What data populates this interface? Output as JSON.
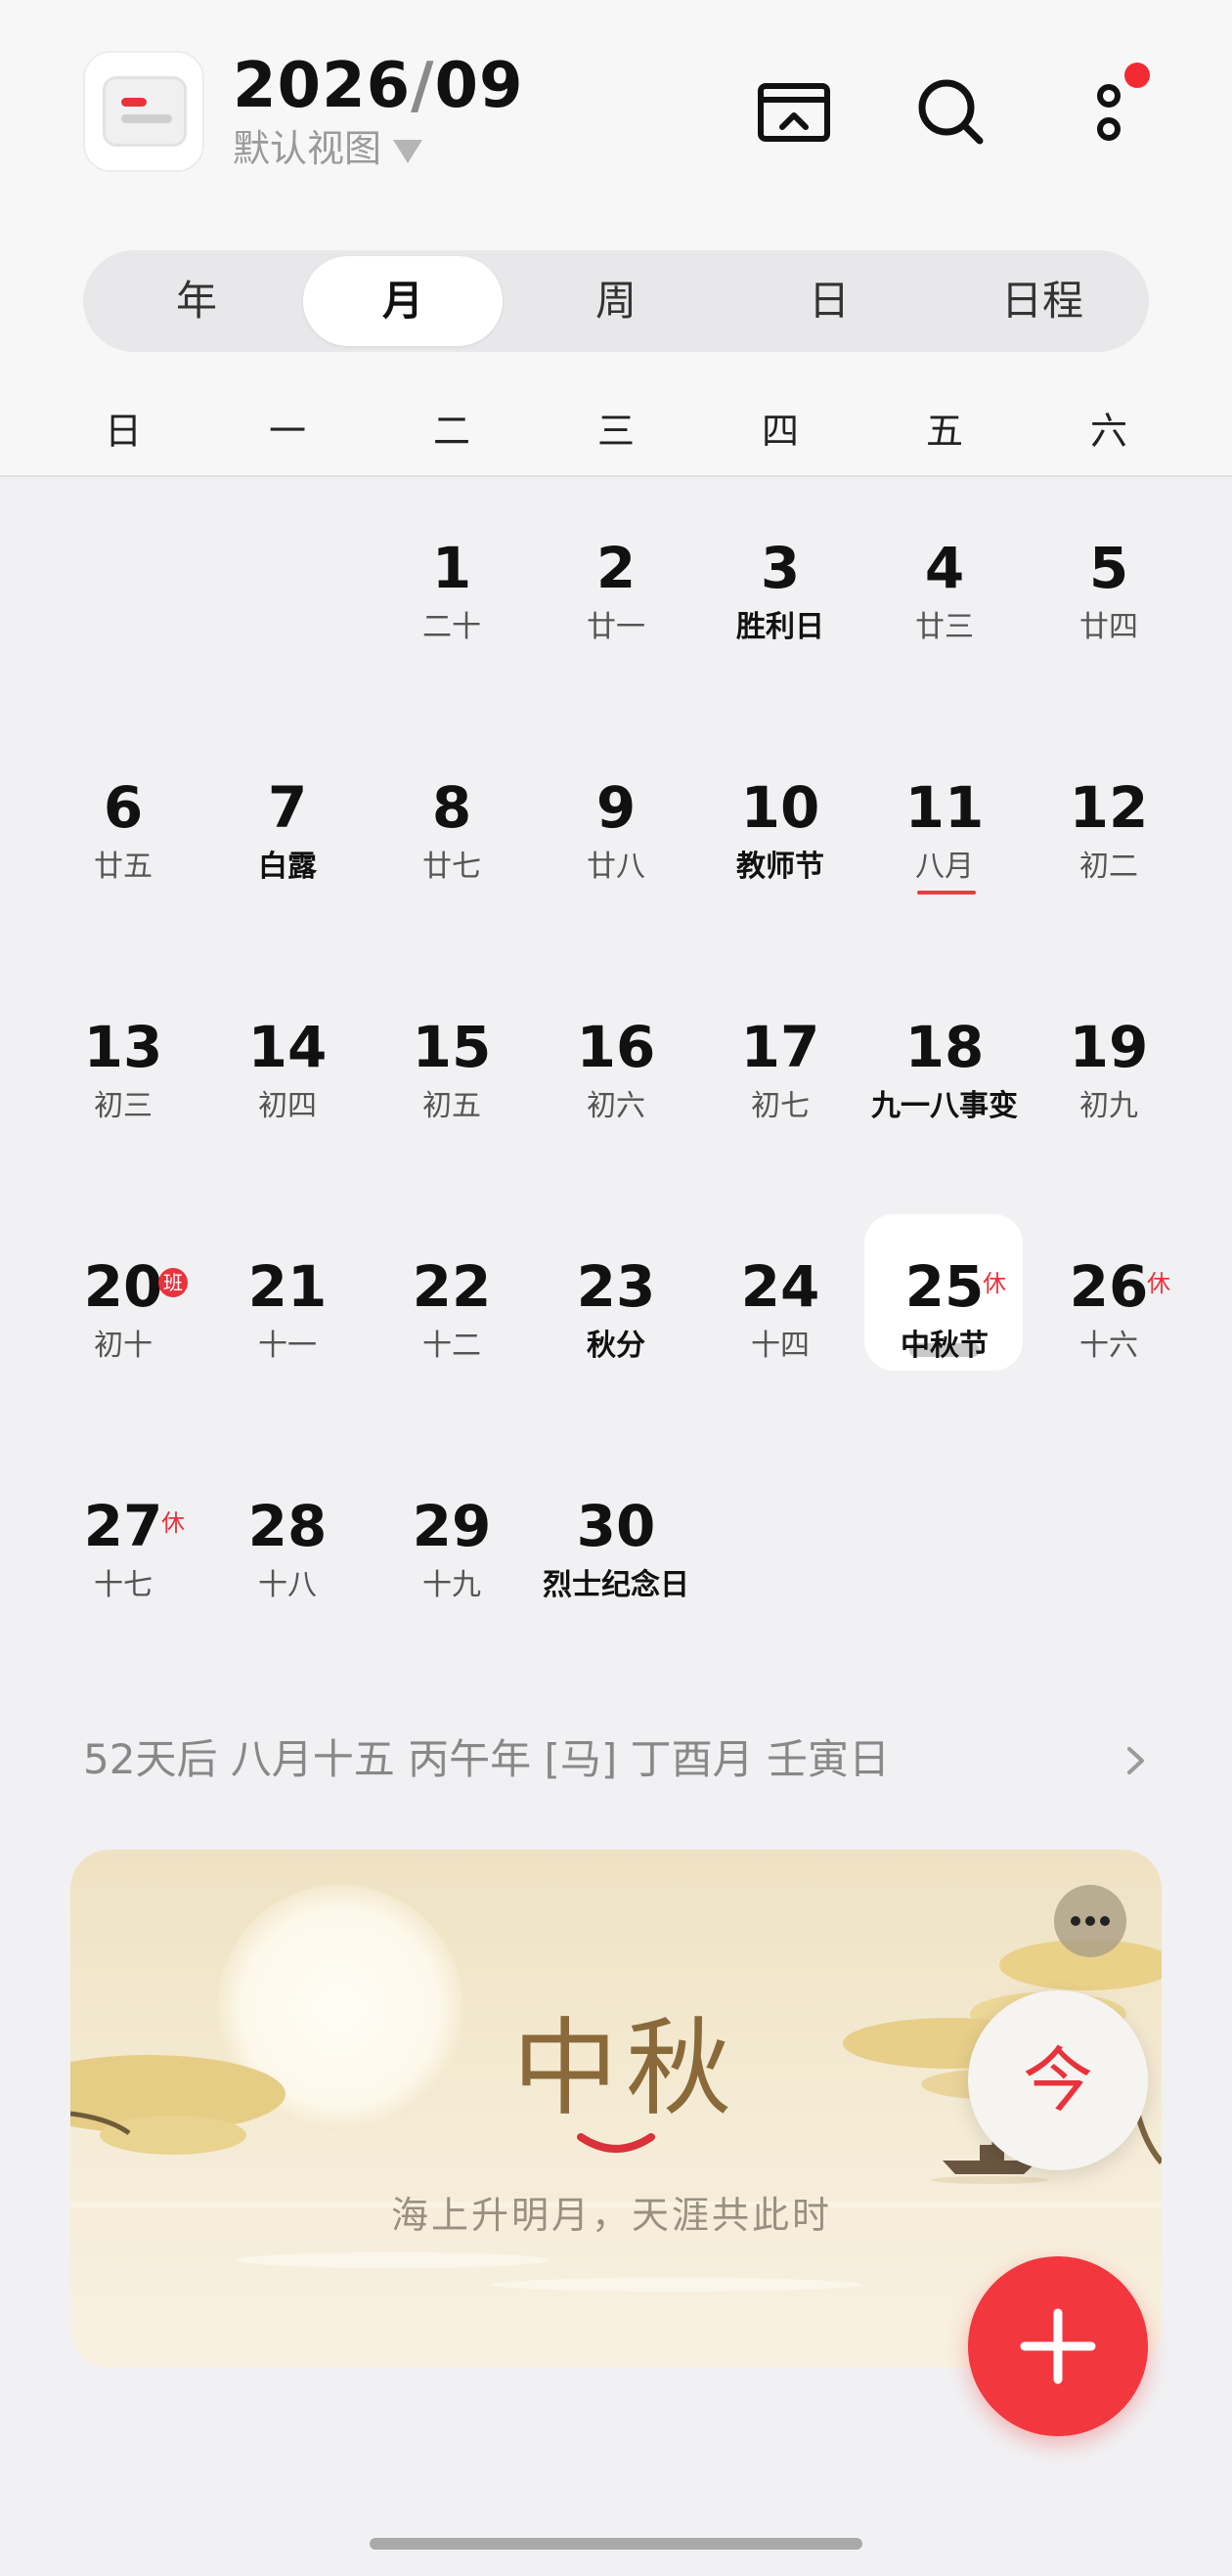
{
  "header": {
    "year": "2026",
    "slash": "/",
    "month": "09",
    "view_selector": "默认视图",
    "icons": [
      "calendar-archive-icon",
      "search-icon",
      "more-vertical-icon"
    ],
    "notification_color": "#f22b32"
  },
  "tabs": [
    {
      "label": "年",
      "active": false
    },
    {
      "label": "月",
      "active": true
    },
    {
      "label": "周",
      "active": false
    },
    {
      "label": "日",
      "active": false
    },
    {
      "label": "日程",
      "active": false
    }
  ],
  "weekdays": [
    "日",
    "一",
    "二",
    "三",
    "四",
    "五",
    "六"
  ],
  "calendar": {
    "weeks": [
      [
        null,
        null,
        {
          "day": "1",
          "lunar": "二十"
        },
        {
          "day": "2",
          "lunar": "廿一"
        },
        {
          "day": "3",
          "lunar": "胜利日",
          "festival": true
        },
        {
          "day": "4",
          "lunar": "廿三"
        },
        {
          "day": "5",
          "lunar": "廿四"
        }
      ],
      [
        {
          "day": "6",
          "lunar": "廿五"
        },
        {
          "day": "7",
          "lunar": "白露",
          "festival": true
        },
        {
          "day": "8",
          "lunar": "廿七"
        },
        {
          "day": "9",
          "lunar": "廿八"
        },
        {
          "day": "10",
          "lunar": "教师节",
          "festival": true
        },
        {
          "day": "11",
          "lunar": "八月",
          "underline": true
        },
        {
          "day": "12",
          "lunar": "初二"
        }
      ],
      [
        {
          "day": "13",
          "lunar": "初三"
        },
        {
          "day": "14",
          "lunar": "初四"
        },
        {
          "day": "15",
          "lunar": "初五"
        },
        {
          "day": "16",
          "lunar": "初六"
        },
        {
          "day": "17",
          "lunar": "初七"
        },
        {
          "day": "18",
          "lunar": "九一八事变",
          "festival": true
        },
        {
          "day": "19",
          "lunar": "初九"
        }
      ],
      [
        {
          "day": "20",
          "lunar": "初十",
          "badge": "班"
        },
        {
          "day": "21",
          "lunar": "十一"
        },
        {
          "day": "22",
          "lunar": "十二"
        },
        {
          "day": "23",
          "lunar": "秋分",
          "festival": true
        },
        {
          "day": "24",
          "lunar": "十四"
        },
        {
          "day": "25",
          "lunar": "中秋节",
          "festival": true,
          "rest": "休",
          "selected": true
        },
        {
          "day": "26",
          "lunar": "十六",
          "rest": "休"
        }
      ],
      [
        {
          "day": "27",
          "lunar": "十七",
          "rest": "休"
        },
        {
          "day": "28",
          "lunar": "十八"
        },
        {
          "day": "29",
          "lunar": "十九"
        },
        {
          "day": "30",
          "lunar": "烈士纪念日",
          "festival": true
        },
        null,
        null,
        null
      ]
    ]
  },
  "info_line": "52天后 八月十五 丙午年 [马] 丁酉月 壬寅日",
  "festival_card": {
    "title": "中秋",
    "poem": "海上升明月，天涯共此时"
  },
  "fab": {
    "today_label": "今"
  },
  "colors": {
    "accent": "#e8333c",
    "rest": "#e8333c"
  }
}
